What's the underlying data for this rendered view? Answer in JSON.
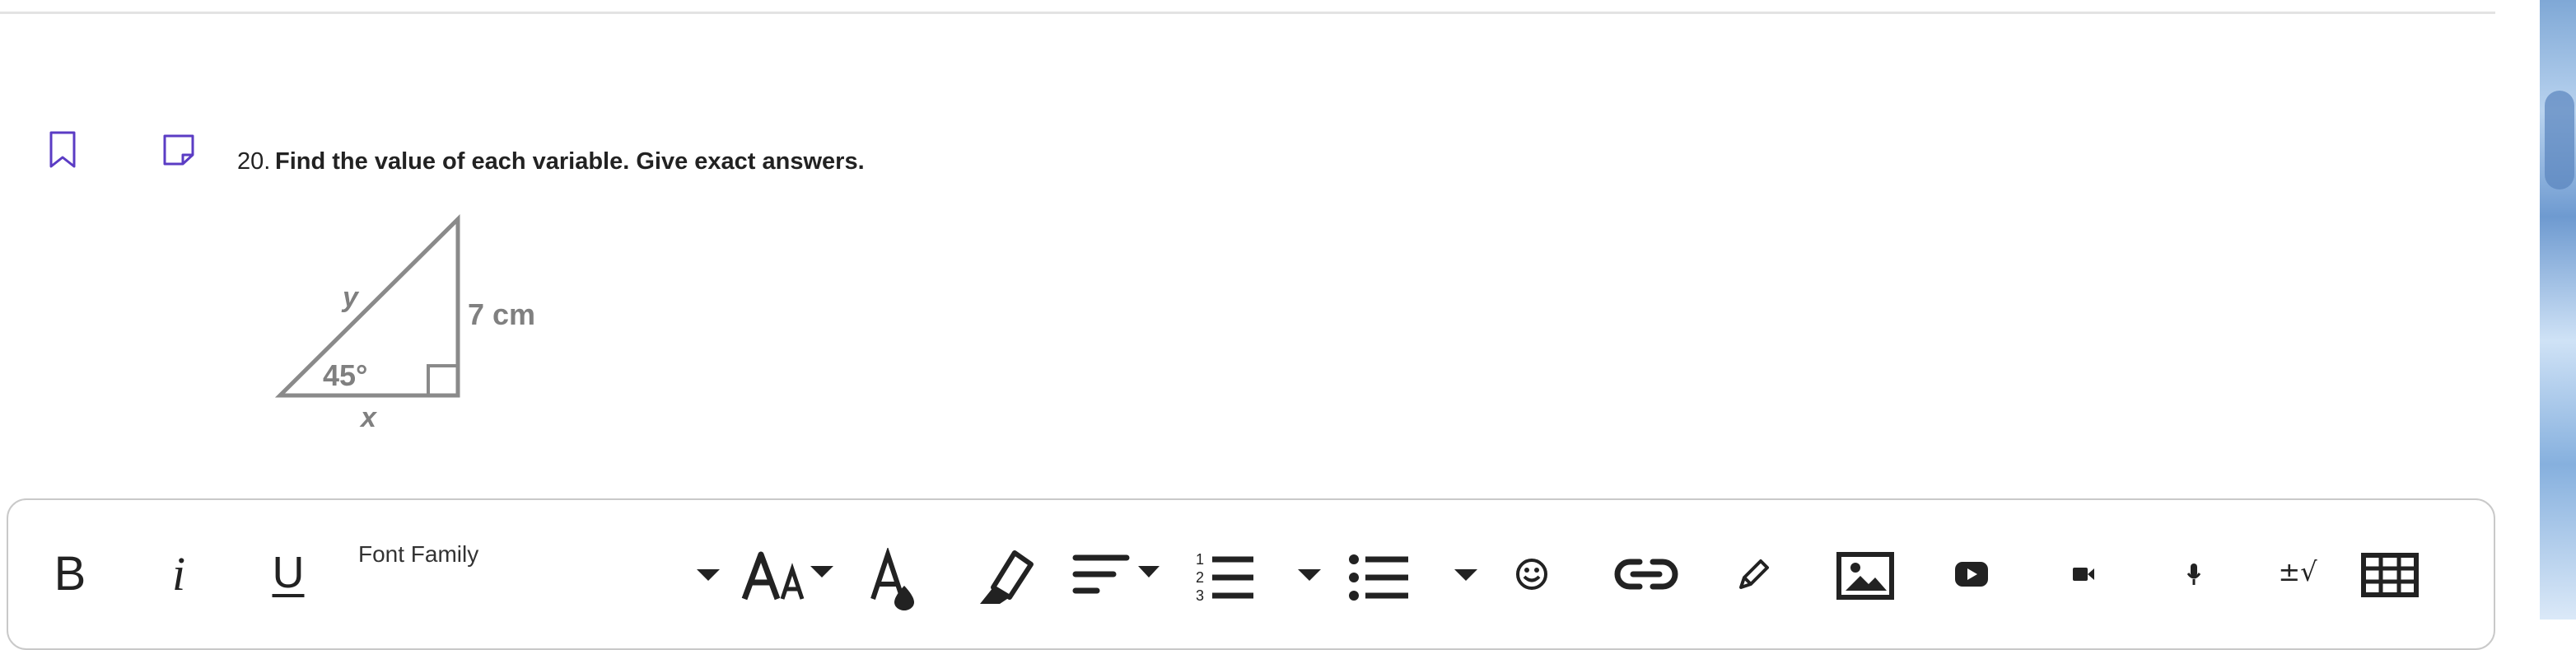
{
  "question": {
    "number": "20.",
    "text": "Find the value of each variable.  Give exact answers."
  },
  "figure": {
    "hypotenuse_label": "y",
    "side_label": "7 cm",
    "base_label": "x",
    "angle_label": "45°"
  },
  "toolbar": {
    "font_family_label": "Font Family",
    "bold_label": "B",
    "italic_label": "i",
    "underline_label": "U",
    "math_label": "±√",
    "icons": [
      "bold-icon",
      "italic-icon",
      "underline-icon",
      "chevron-down-icon",
      "font-size-icon",
      "font-color-icon",
      "highlight-icon",
      "align-icon",
      "numbered-list-icon",
      "bullet-list-icon",
      "emoji-icon",
      "link-icon",
      "pencil-icon",
      "image-icon",
      "youtube-icon",
      "video-icon",
      "microphone-icon",
      "math-icon",
      "table-icon"
    ]
  },
  "colors": {
    "accent": "#5b3cc4",
    "figure_stroke": "#8a8a8a",
    "toolbar_icon": "#222222"
  }
}
